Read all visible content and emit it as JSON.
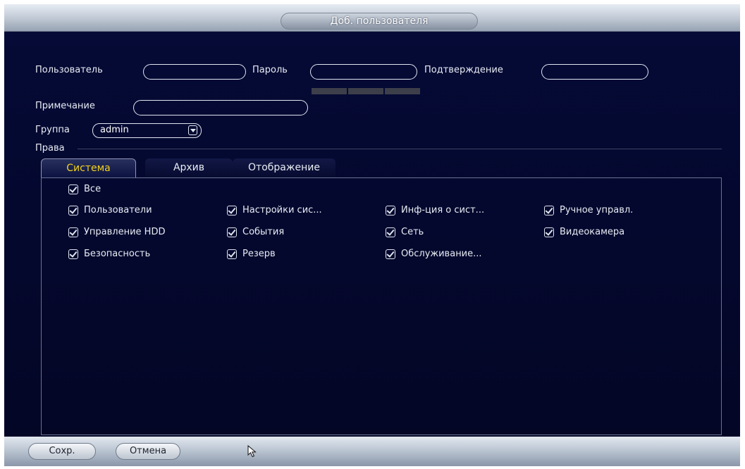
{
  "dialog": {
    "title": "Доб. пользователя"
  },
  "form": {
    "user_label": "Пользователь",
    "user_value": "",
    "password_label": "Пароль",
    "password_value": "",
    "confirm_label": "Подтверждение",
    "confirm_value": "",
    "note_label": "Примечание",
    "note_value": "",
    "group_label": "Группа",
    "group_value": "admin",
    "rights_label": "Права"
  },
  "tabs": [
    {
      "label": "Система",
      "active": true
    },
    {
      "label": "Архив",
      "active": false
    },
    {
      "label": "Отображение",
      "active": false
    }
  ],
  "permissions": {
    "all": {
      "label": "Все",
      "checked": true
    },
    "items": [
      {
        "label": "Пользователи",
        "checked": true
      },
      {
        "label": "Настройки сис...",
        "checked": true
      },
      {
        "label": "Инф-ция о сист...",
        "checked": true
      },
      {
        "label": "Ручное управл.",
        "checked": true
      },
      {
        "label": "Управление HDD",
        "checked": true
      },
      {
        "label": "События",
        "checked": true
      },
      {
        "label": "Сеть",
        "checked": true
      },
      {
        "label": "Видеокамера",
        "checked": true
      },
      {
        "label": "Безопасность",
        "checked": true
      },
      {
        "label": "Резерв",
        "checked": true
      },
      {
        "label": "Обслуживание...",
        "checked": true
      }
    ]
  },
  "footer": {
    "save_label": "Сохр.",
    "cancel_label": "Отмена"
  }
}
